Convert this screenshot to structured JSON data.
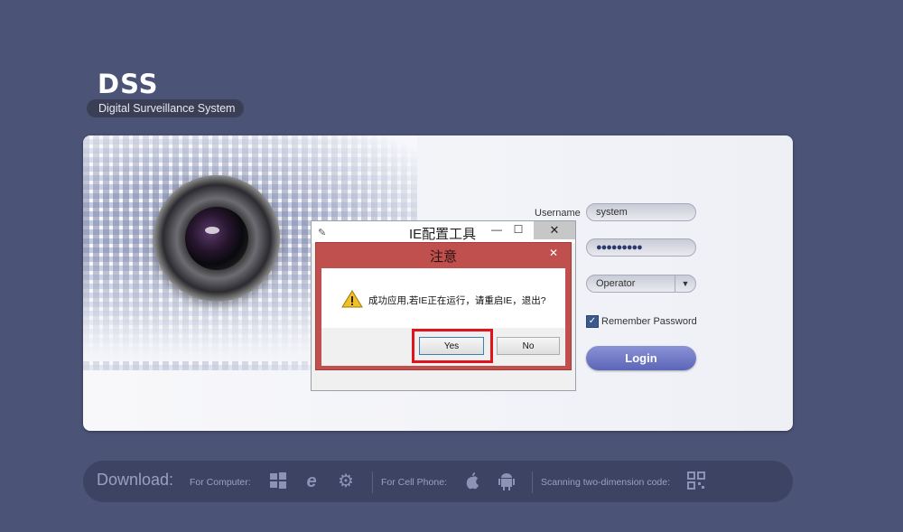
{
  "brand": {
    "logo": "DSS",
    "subtitle": "Digital Surveillance System"
  },
  "login": {
    "username_label": "Username",
    "username_value": "system",
    "password_value": "●●●●●●●●●",
    "role_value": "Operator",
    "remember_label": "Remember Password",
    "remember_checked": true,
    "login_label": "Login"
  },
  "ie_window": {
    "title": "IE配置工具",
    "close": "✕",
    "minimize": "—",
    "maximize": "☐"
  },
  "dialog": {
    "title": "注意",
    "close": "✕",
    "message": "成功应用,若IE正在运行，请重启IE，退出?",
    "yes_label": "Yes",
    "no_label": "No"
  },
  "download": {
    "title": "Download:",
    "computer_label": "For Computer:",
    "phone_label": "For Cell Phone:",
    "scan_label": "Scanning two-dimension code:"
  },
  "colors": {
    "background": "#4b5377",
    "dialog_red": "#c0504d",
    "highlight": "#e0141c",
    "login_button": "#6a74c4"
  }
}
